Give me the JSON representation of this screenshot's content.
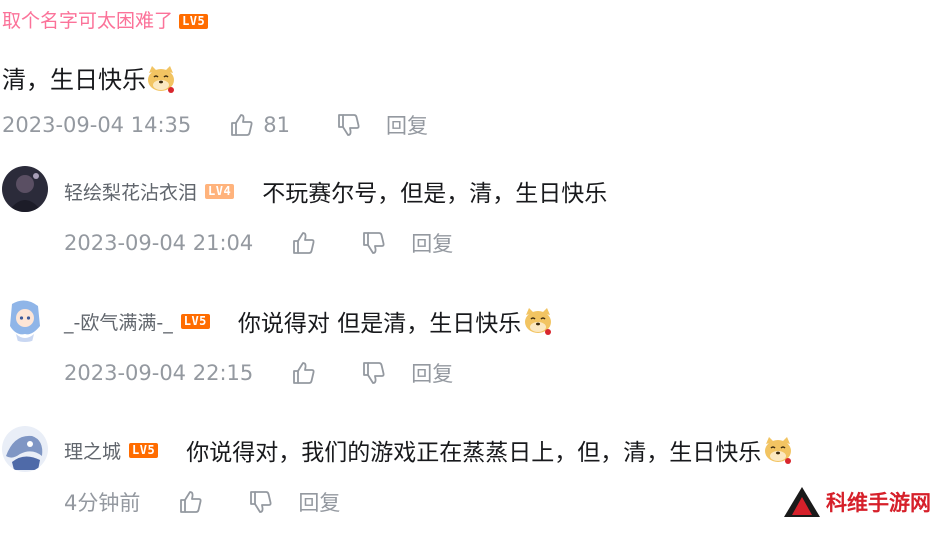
{
  "top_comment": {
    "username": "取个名字可太困难了",
    "level": "LV5",
    "text": "清，生日快乐",
    "time": "2023-09-04 14:35",
    "likes": "81",
    "reply_label": "回复"
  },
  "replies": [
    {
      "username": "轻绘梨花沾衣泪",
      "level": "LV4",
      "text": "不玩赛尔号，但是，清，生日快乐",
      "time": "2023-09-04 21:04",
      "reply_label": "回复"
    },
    {
      "username": "_-欧气满满-_",
      "level": "LV5",
      "text": "你说得对  但是清，生日快乐",
      "time": "2023-09-04 22:15",
      "reply_label": "回复"
    },
    {
      "username": "理之城",
      "level": "LV5",
      "text": "你说得对，我们的游戏正在蒸蒸日上，但，清，生日快乐",
      "time": "4分钟前",
      "reply_label": "回复"
    }
  ],
  "watermark": {
    "text": "科维手游网"
  },
  "colors": {
    "username_pink": "#fb7299",
    "meta_gray": "#9499a0",
    "level5": "#ff6c00",
    "level4": "#ffb37c",
    "watermark_red": "#d6202a"
  },
  "icons": [
    "thumb-up-icon",
    "thumb-down-icon",
    "doge-emoji-icon"
  ]
}
